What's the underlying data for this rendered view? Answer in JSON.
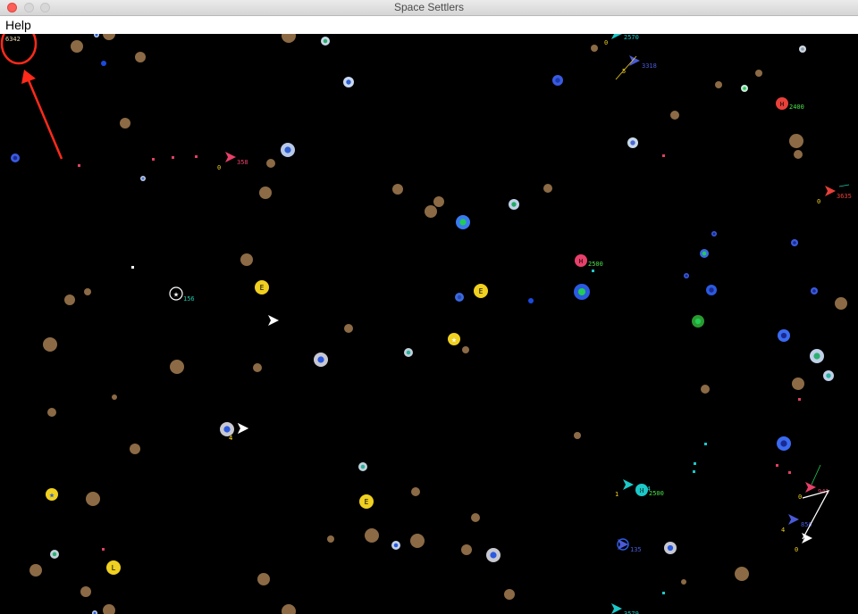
{
  "window": {
    "title": "Space Settlers",
    "controls": [
      "close",
      "minimize",
      "maximize"
    ]
  },
  "menu": {
    "items": [
      {
        "label": "Help"
      }
    ]
  },
  "game": {
    "background": "#000000",
    "timestep_readout": "6342",
    "annotation": {
      "type": "red-circle-and-arrow",
      "color": "#ff2a1a",
      "target": "timestep_readout"
    },
    "bases": [
      {
        "letter": "H",
        "energy": "2400",
        "color": "#e8403a",
        "label_color": "#4be04b"
      },
      {
        "letter": "H",
        "energy": "2500",
        "color": "#e8406a",
        "label_color": "#4be04b"
      },
      {
        "letter": "H",
        "energy": "2500",
        "color": "#1cc8c8",
        "label_color": "#4be04b"
      }
    ],
    "energy_beacons": [
      "E",
      "E",
      "E",
      "L"
    ],
    "ships": [
      {
        "team_color": "#e8406a",
        "energy": "358",
        "resources": "0"
      },
      {
        "team_color": "#4a5ad8",
        "energy": "3318",
        "resources": "5"
      },
      {
        "team_color": "#e8403a",
        "energy": "3635",
        "resources": "0"
      },
      {
        "team_color": "#1cc8c8",
        "energy": "2570",
        "resources": "0"
      },
      {
        "team_color": "#ffffff",
        "energy": "156",
        "resources": ""
      },
      {
        "team_color": "#ffffff",
        "energy": "",
        "resources": "4"
      },
      {
        "team_color": "#ffffff",
        "energy": "",
        "resources": "4"
      },
      {
        "team_color": "#1cc8c8",
        "energy": "3574",
        "resources": "1"
      },
      {
        "team_color": "#e8406a",
        "energy": "941",
        "resources": "0"
      },
      {
        "team_color": "#4a5ad8",
        "energy": "856",
        "resources": "4"
      },
      {
        "team_color": "#ffffff",
        "energy": "",
        "resources": "0"
      },
      {
        "team_color": "#1cc8c8",
        "energy": "3579",
        "resources": ""
      },
      {
        "team_color": "#4a5ad8",
        "energy": "135",
        "resources": ""
      }
    ],
    "colors": {
      "asteroid": "#8b6a45",
      "mineable_ring": "#b8c8e8",
      "blue_asteroid": "#2f5fd0",
      "green_core": "#22cc55"
    }
  }
}
